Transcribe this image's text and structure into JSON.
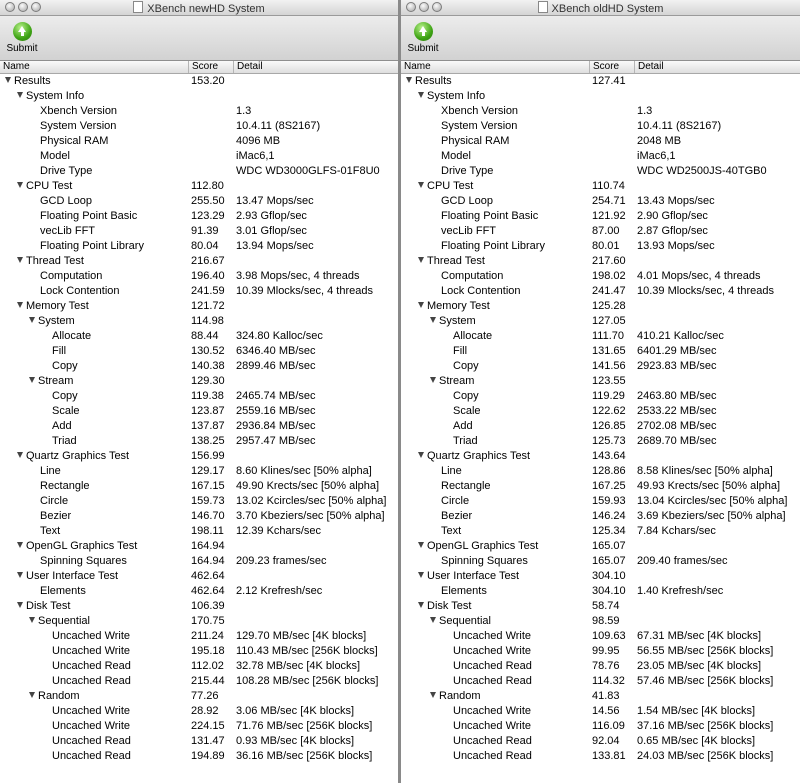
{
  "columns": {
    "name": "Name",
    "score": "Score",
    "detail": "Detail"
  },
  "submit_label": "Submit",
  "icons": {
    "submit": "submit-arrow-icon",
    "expander": "disclosure-triangle-icon"
  },
  "accent": "#3ea314",
  "windows": [
    {
      "title": "XBench newHD System",
      "rows": [
        {
          "level": 0,
          "expand": true,
          "name": "Results",
          "score": "153.20",
          "detail": ""
        },
        {
          "level": 1,
          "expand": true,
          "name": "System Info",
          "score": "",
          "detail": ""
        },
        {
          "level": 2,
          "expand": false,
          "name": "Xbench Version",
          "score": "",
          "detail": "1.3"
        },
        {
          "level": 2,
          "expand": false,
          "name": "System Version",
          "score": "",
          "detail": "10.4.11 (8S2167)"
        },
        {
          "level": 2,
          "expand": false,
          "name": "Physical RAM",
          "score": "",
          "detail": "4096 MB"
        },
        {
          "level": 2,
          "expand": false,
          "name": "Model",
          "score": "",
          "detail": "iMac6,1"
        },
        {
          "level": 2,
          "expand": false,
          "name": "Drive Type",
          "score": "",
          "detail": "WDC WD3000GLFS-01F8U0"
        },
        {
          "level": 1,
          "expand": true,
          "name": "CPU Test",
          "score": "112.80",
          "detail": ""
        },
        {
          "level": 2,
          "expand": false,
          "name": "GCD Loop",
          "score": "255.50",
          "detail": "13.47 Mops/sec"
        },
        {
          "level": 2,
          "expand": false,
          "name": "Floating Point Basic",
          "score": "123.29",
          "detail": "2.93 Gflop/sec"
        },
        {
          "level": 2,
          "expand": false,
          "name": "vecLib FFT",
          "score": "91.39",
          "detail": "3.01 Gflop/sec"
        },
        {
          "level": 2,
          "expand": false,
          "name": "Floating Point Library",
          "score": "80.04",
          "detail": "13.94 Mops/sec"
        },
        {
          "level": 1,
          "expand": true,
          "name": "Thread Test",
          "score": "216.67",
          "detail": ""
        },
        {
          "level": 2,
          "expand": false,
          "name": "Computation",
          "score": "196.40",
          "detail": "3.98 Mops/sec, 4 threads"
        },
        {
          "level": 2,
          "expand": false,
          "name": "Lock Contention",
          "score": "241.59",
          "detail": "10.39 Mlocks/sec, 4 threads"
        },
        {
          "level": 1,
          "expand": true,
          "name": "Memory Test",
          "score": "121.72",
          "detail": ""
        },
        {
          "level": 2,
          "expand": true,
          "name": "System",
          "score": "114.98",
          "detail": ""
        },
        {
          "level": 3,
          "expand": false,
          "name": "Allocate",
          "score": "88.44",
          "detail": "324.80 Kalloc/sec"
        },
        {
          "level": 3,
          "expand": false,
          "name": "Fill",
          "score": "130.52",
          "detail": "6346.40 MB/sec"
        },
        {
          "level": 3,
          "expand": false,
          "name": "Copy",
          "score": "140.38",
          "detail": "2899.46 MB/sec"
        },
        {
          "level": 2,
          "expand": true,
          "name": "Stream",
          "score": "129.30",
          "detail": ""
        },
        {
          "level": 3,
          "expand": false,
          "name": "Copy",
          "score": "119.38",
          "detail": "2465.74 MB/sec"
        },
        {
          "level": 3,
          "expand": false,
          "name": "Scale",
          "score": "123.87",
          "detail": "2559.16 MB/sec"
        },
        {
          "level": 3,
          "expand": false,
          "name": "Add",
          "score": "137.87",
          "detail": "2936.84 MB/sec"
        },
        {
          "level": 3,
          "expand": false,
          "name": "Triad",
          "score": "138.25",
          "detail": "2957.47 MB/sec"
        },
        {
          "level": 1,
          "expand": true,
          "name": "Quartz Graphics Test",
          "score": "156.99",
          "detail": ""
        },
        {
          "level": 2,
          "expand": false,
          "name": "Line",
          "score": "129.17",
          "detail": "8.60 Klines/sec [50% alpha]"
        },
        {
          "level": 2,
          "expand": false,
          "name": "Rectangle",
          "score": "167.15",
          "detail": "49.90 Krects/sec [50% alpha]"
        },
        {
          "level": 2,
          "expand": false,
          "name": "Circle",
          "score": "159.73",
          "detail": "13.02 Kcircles/sec [50% alpha]"
        },
        {
          "level": 2,
          "expand": false,
          "name": "Bezier",
          "score": "146.70",
          "detail": "3.70 Kbeziers/sec [50% alpha]"
        },
        {
          "level": 2,
          "expand": false,
          "name": "Text",
          "score": "198.11",
          "detail": "12.39 Kchars/sec"
        },
        {
          "level": 1,
          "expand": true,
          "name": "OpenGL Graphics Test",
          "score": "164.94",
          "detail": ""
        },
        {
          "level": 2,
          "expand": false,
          "name": "Spinning Squares",
          "score": "164.94",
          "detail": "209.23 frames/sec"
        },
        {
          "level": 1,
          "expand": true,
          "name": "User Interface Test",
          "score": "462.64",
          "detail": ""
        },
        {
          "level": 2,
          "expand": false,
          "name": "Elements",
          "score": "462.64",
          "detail": "2.12 Krefresh/sec"
        },
        {
          "level": 1,
          "expand": true,
          "name": "Disk Test",
          "score": "106.39",
          "detail": ""
        },
        {
          "level": 2,
          "expand": true,
          "name": "Sequential",
          "score": "170.75",
          "detail": ""
        },
        {
          "level": 3,
          "expand": false,
          "name": "Uncached Write",
          "score": "211.24",
          "detail": "129.70 MB/sec [4K blocks]"
        },
        {
          "level": 3,
          "expand": false,
          "name": "Uncached Write",
          "score": "195.18",
          "detail": "110.43 MB/sec [256K blocks]"
        },
        {
          "level": 3,
          "expand": false,
          "name": "Uncached Read",
          "score": "112.02",
          "detail": "32.78 MB/sec [4K blocks]"
        },
        {
          "level": 3,
          "expand": false,
          "name": "Uncached Read",
          "score": "215.44",
          "detail": "108.28 MB/sec [256K blocks]"
        },
        {
          "level": 2,
          "expand": true,
          "name": "Random",
          "score": "77.26",
          "detail": ""
        },
        {
          "level": 3,
          "expand": false,
          "name": "Uncached Write",
          "score": "28.92",
          "detail": "3.06 MB/sec [4K blocks]"
        },
        {
          "level": 3,
          "expand": false,
          "name": "Uncached Write",
          "score": "224.15",
          "detail": "71.76 MB/sec [256K blocks]"
        },
        {
          "level": 3,
          "expand": false,
          "name": "Uncached Read",
          "score": "131.47",
          "detail": "0.93 MB/sec [4K blocks]"
        },
        {
          "level": 3,
          "expand": false,
          "name": "Uncached Read",
          "score": "194.89",
          "detail": "36.16 MB/sec [256K blocks]"
        }
      ]
    },
    {
      "title": "XBench oldHD System",
      "rows": [
        {
          "level": 0,
          "expand": true,
          "name": "Results",
          "score": "127.41",
          "detail": ""
        },
        {
          "level": 1,
          "expand": true,
          "name": "System Info",
          "score": "",
          "detail": ""
        },
        {
          "level": 2,
          "expand": false,
          "name": "Xbench Version",
          "score": "",
          "detail": "1.3"
        },
        {
          "level": 2,
          "expand": false,
          "name": "System Version",
          "score": "",
          "detail": "10.4.11 (8S2167)"
        },
        {
          "level": 2,
          "expand": false,
          "name": "Physical RAM",
          "score": "",
          "detail": "2048 MB"
        },
        {
          "level": 2,
          "expand": false,
          "name": "Model",
          "score": "",
          "detail": "iMac6,1"
        },
        {
          "level": 2,
          "expand": false,
          "name": "Drive Type",
          "score": "",
          "detail": "WDC WD2500JS-40TGB0"
        },
        {
          "level": 1,
          "expand": true,
          "name": "CPU Test",
          "score": "110.74",
          "detail": ""
        },
        {
          "level": 2,
          "expand": false,
          "name": "GCD Loop",
          "score": "254.71",
          "detail": "13.43 Mops/sec"
        },
        {
          "level": 2,
          "expand": false,
          "name": "Floating Point Basic",
          "score": "121.92",
          "detail": "2.90 Gflop/sec"
        },
        {
          "level": 2,
          "expand": false,
          "name": "vecLib FFT",
          "score": "87.00",
          "detail": "2.87 Gflop/sec"
        },
        {
          "level": 2,
          "expand": false,
          "name": "Floating Point Library",
          "score": "80.01",
          "detail": "13.93 Mops/sec"
        },
        {
          "level": 1,
          "expand": true,
          "name": "Thread Test",
          "score": "217.60",
          "detail": ""
        },
        {
          "level": 2,
          "expand": false,
          "name": "Computation",
          "score": "198.02",
          "detail": "4.01 Mops/sec, 4 threads"
        },
        {
          "level": 2,
          "expand": false,
          "name": "Lock Contention",
          "score": "241.47",
          "detail": "10.39 Mlocks/sec, 4 threads"
        },
        {
          "level": 1,
          "expand": true,
          "name": "Memory Test",
          "score": "125.28",
          "detail": ""
        },
        {
          "level": 2,
          "expand": true,
          "name": "System",
          "score": "127.05",
          "detail": ""
        },
        {
          "level": 3,
          "expand": false,
          "name": "Allocate",
          "score": "111.70",
          "detail": "410.21 Kalloc/sec"
        },
        {
          "level": 3,
          "expand": false,
          "name": "Fill",
          "score": "131.65",
          "detail": "6401.29 MB/sec"
        },
        {
          "level": 3,
          "expand": false,
          "name": "Copy",
          "score": "141.56",
          "detail": "2923.83 MB/sec"
        },
        {
          "level": 2,
          "expand": true,
          "name": "Stream",
          "score": "123.55",
          "detail": ""
        },
        {
          "level": 3,
          "expand": false,
          "name": "Copy",
          "score": "119.29",
          "detail": "2463.80 MB/sec"
        },
        {
          "level": 3,
          "expand": false,
          "name": "Scale",
          "score": "122.62",
          "detail": "2533.22 MB/sec"
        },
        {
          "level": 3,
          "expand": false,
          "name": "Add",
          "score": "126.85",
          "detail": "2702.08 MB/sec"
        },
        {
          "level": 3,
          "expand": false,
          "name": "Triad",
          "score": "125.73",
          "detail": "2689.70 MB/sec"
        },
        {
          "level": 1,
          "expand": true,
          "name": "Quartz Graphics Test",
          "score": "143.64",
          "detail": ""
        },
        {
          "level": 2,
          "expand": false,
          "name": "Line",
          "score": "128.86",
          "detail": "8.58 Klines/sec [50% alpha]"
        },
        {
          "level": 2,
          "expand": false,
          "name": "Rectangle",
          "score": "167.25",
          "detail": "49.93 Krects/sec [50% alpha]"
        },
        {
          "level": 2,
          "expand": false,
          "name": "Circle",
          "score": "159.93",
          "detail": "13.04 Kcircles/sec [50% alpha]"
        },
        {
          "level": 2,
          "expand": false,
          "name": "Bezier",
          "score": "146.24",
          "detail": "3.69 Kbeziers/sec [50% alpha]"
        },
        {
          "level": 2,
          "expand": false,
          "name": "Text",
          "score": "125.34",
          "detail": "7.84 Kchars/sec"
        },
        {
          "level": 1,
          "expand": true,
          "name": "OpenGL Graphics Test",
          "score": "165.07",
          "detail": ""
        },
        {
          "level": 2,
          "expand": false,
          "name": "Spinning Squares",
          "score": "165.07",
          "detail": "209.40 frames/sec"
        },
        {
          "level": 1,
          "expand": true,
          "name": "User Interface Test",
          "score": "304.10",
          "detail": ""
        },
        {
          "level": 2,
          "expand": false,
          "name": "Elements",
          "score": "304.10",
          "detail": "1.40 Krefresh/sec"
        },
        {
          "level": 1,
          "expand": true,
          "name": "Disk Test",
          "score": "58.74",
          "detail": ""
        },
        {
          "level": 2,
          "expand": true,
          "name": "Sequential",
          "score": "98.59",
          "detail": ""
        },
        {
          "level": 3,
          "expand": false,
          "name": "Uncached Write",
          "score": "109.63",
          "detail": "67.31 MB/sec [4K blocks]"
        },
        {
          "level": 3,
          "expand": false,
          "name": "Uncached Write",
          "score": "99.95",
          "detail": "56.55 MB/sec [256K blocks]"
        },
        {
          "level": 3,
          "expand": false,
          "name": "Uncached Read",
          "score": "78.76",
          "detail": "23.05 MB/sec [4K blocks]"
        },
        {
          "level": 3,
          "expand": false,
          "name": "Uncached Read",
          "score": "114.32",
          "detail": "57.46 MB/sec [256K blocks]"
        },
        {
          "level": 2,
          "expand": true,
          "name": "Random",
          "score": "41.83",
          "detail": ""
        },
        {
          "level": 3,
          "expand": false,
          "name": "Uncached Write",
          "score": "14.56",
          "detail": "1.54 MB/sec [4K blocks]"
        },
        {
          "level": 3,
          "expand": false,
          "name": "Uncached Write",
          "score": "116.09",
          "detail": "37.16 MB/sec [256K blocks]"
        },
        {
          "level": 3,
          "expand": false,
          "name": "Uncached Read",
          "score": "92.04",
          "detail": "0.65 MB/sec [4K blocks]"
        },
        {
          "level": 3,
          "expand": false,
          "name": "Uncached Read",
          "score": "133.81",
          "detail": "24.03 MB/sec [256K blocks]"
        }
      ]
    }
  ]
}
